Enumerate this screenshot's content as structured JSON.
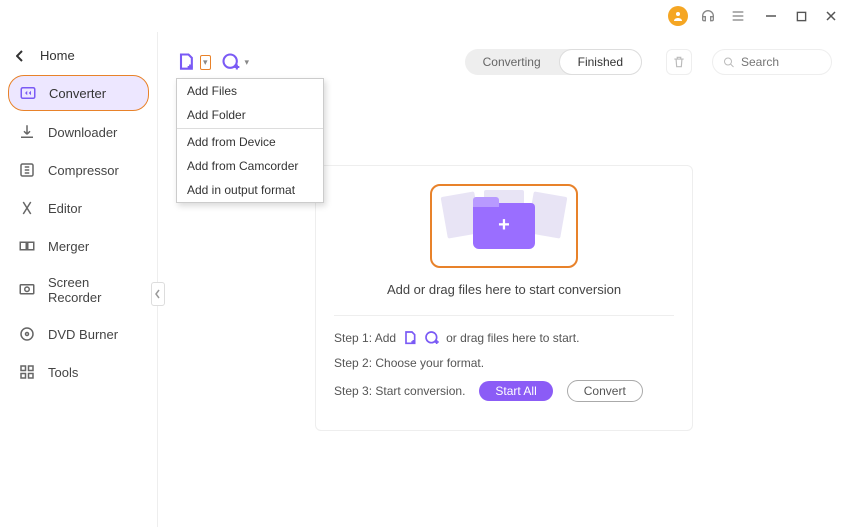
{
  "titlebar": {
    "min": "",
    "max": "",
    "close": ""
  },
  "sidebar": {
    "home_label": "Home",
    "items": [
      {
        "label": "Converter"
      },
      {
        "label": "Downloader"
      },
      {
        "label": "Compressor"
      },
      {
        "label": "Editor"
      },
      {
        "label": "Merger"
      },
      {
        "label": "Screen Recorder"
      },
      {
        "label": "DVD Burner"
      },
      {
        "label": "Tools"
      }
    ]
  },
  "toolbar": {
    "tabs": {
      "converting": "Converting",
      "finished": "Finished"
    },
    "search_placeholder": "Search"
  },
  "dropdown": {
    "add_files": "Add Files",
    "add_folder": "Add Folder",
    "add_device": "Add from Device",
    "add_camcorder": "Add from Camcorder",
    "add_output": "Add in output format"
  },
  "dropzone": {
    "message": "Add or drag files here to start conversion"
  },
  "steps": {
    "s1_prefix": "Step 1: Add",
    "s1_suffix": "or drag files here to start.",
    "s2": "Step 2: Choose your format.",
    "s3": "Step 3: Start conversion.",
    "start_all": "Start All",
    "convert": "Convert"
  }
}
